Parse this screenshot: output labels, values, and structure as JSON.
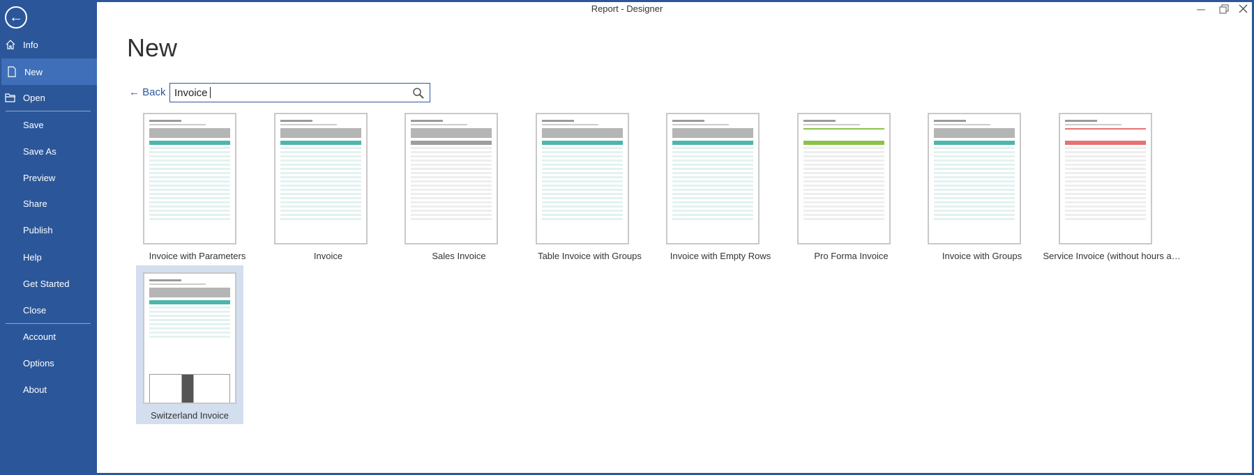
{
  "window": {
    "title": "Report - Designer"
  },
  "sidebar": {
    "items": [
      {
        "label": "Info",
        "icon": "home-icon"
      },
      {
        "label": "New",
        "icon": "document-icon",
        "active": true
      },
      {
        "label": "Open",
        "icon": "folder-icon"
      },
      {
        "label": "Save"
      },
      {
        "label": "Save As"
      },
      {
        "label": "Preview"
      },
      {
        "label": "Share"
      },
      {
        "label": "Publish"
      },
      {
        "label": "Help"
      },
      {
        "label": "Get Started"
      },
      {
        "label": "Close"
      },
      {
        "label": "Account"
      },
      {
        "label": "Options"
      },
      {
        "label": "About"
      }
    ]
  },
  "main": {
    "title": "New",
    "back_label": "Back",
    "search": {
      "value": "Invoice"
    },
    "templates": [
      {
        "label": "Invoice with Parameters",
        "accent": "#4db6ac"
      },
      {
        "label": "Invoice",
        "accent": "#4db6ac"
      },
      {
        "label": "Sales Invoice",
        "accent": "#9e9e9e"
      },
      {
        "label": "Table Invoice with Groups",
        "accent": "#4db6ac"
      },
      {
        "label": "Invoice with Empty Rows",
        "accent": "#4db6ac"
      },
      {
        "label": "Pro Forma Invoice",
        "accent": "#8bc34a"
      },
      {
        "label": "Invoice with Groups",
        "accent": "#4db6ac"
      },
      {
        "label": "Service Invoice (without hours an...",
        "accent": "#e57373"
      },
      {
        "label": "Switzerland Invoice",
        "accent": "#4db6ac",
        "selected": true
      }
    ]
  },
  "colors": {
    "sidebar": "#2b579a",
    "active": "#3f6fb8",
    "selected_tile": "#d3deef"
  }
}
